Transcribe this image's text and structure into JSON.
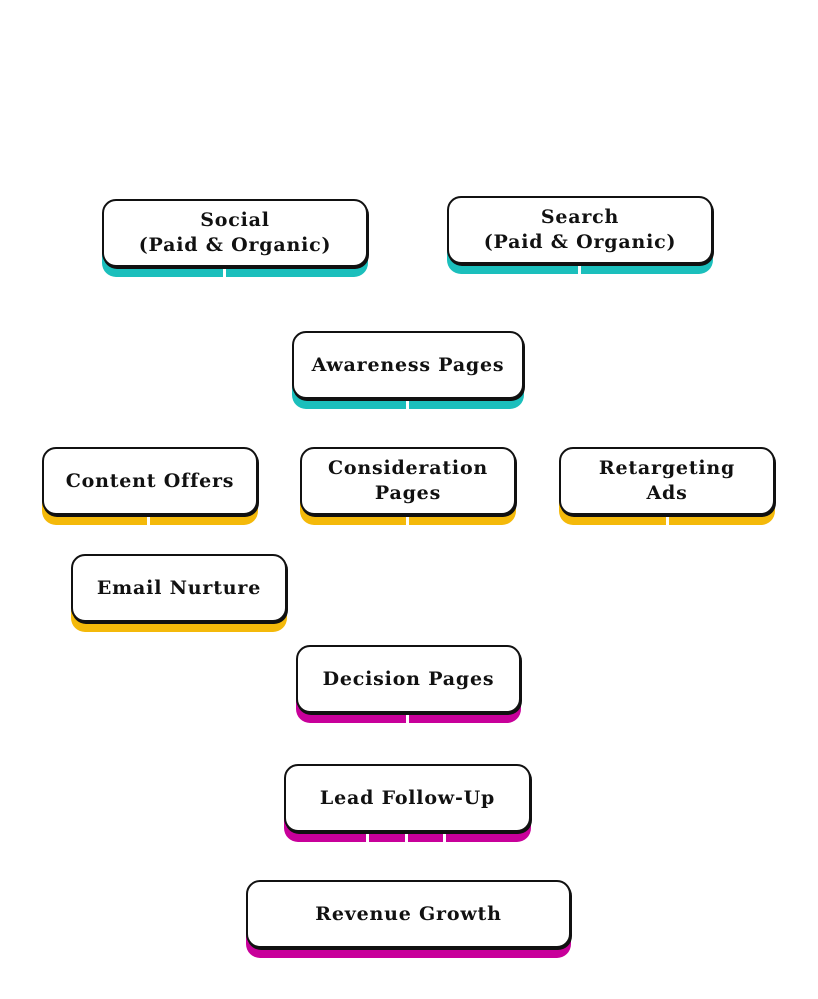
{
  "colors": {
    "awareness": "#1bbfbc",
    "consideration": "#f4b90a",
    "decision": "#c8009a"
  },
  "nodes": [
    {
      "id": "social",
      "label": "Social\n(Paid & Organic)",
      "stage": "awareness"
    },
    {
      "id": "search",
      "label": "Search\n(Paid & Organic)",
      "stage": "awareness"
    },
    {
      "id": "awareness-pages",
      "label": "Awareness Pages",
      "stage": "awareness"
    },
    {
      "id": "content-offers",
      "label": "Content Offers",
      "stage": "consideration"
    },
    {
      "id": "consideration-pages",
      "label": "Consideration\nPages",
      "stage": "consideration"
    },
    {
      "id": "retargeting-ads",
      "label": "Retargeting\nAds",
      "stage": "consideration"
    },
    {
      "id": "email-nurture",
      "label": "Email Nurture",
      "stage": "consideration"
    },
    {
      "id": "decision-pages",
      "label": "Decision Pages",
      "stage": "decision"
    },
    {
      "id": "lead-follow-up",
      "label": "Lead Follow-Up",
      "stage": "decision"
    },
    {
      "id": "revenue-growth",
      "label": "Revenue Growth",
      "stage": "decision"
    }
  ]
}
